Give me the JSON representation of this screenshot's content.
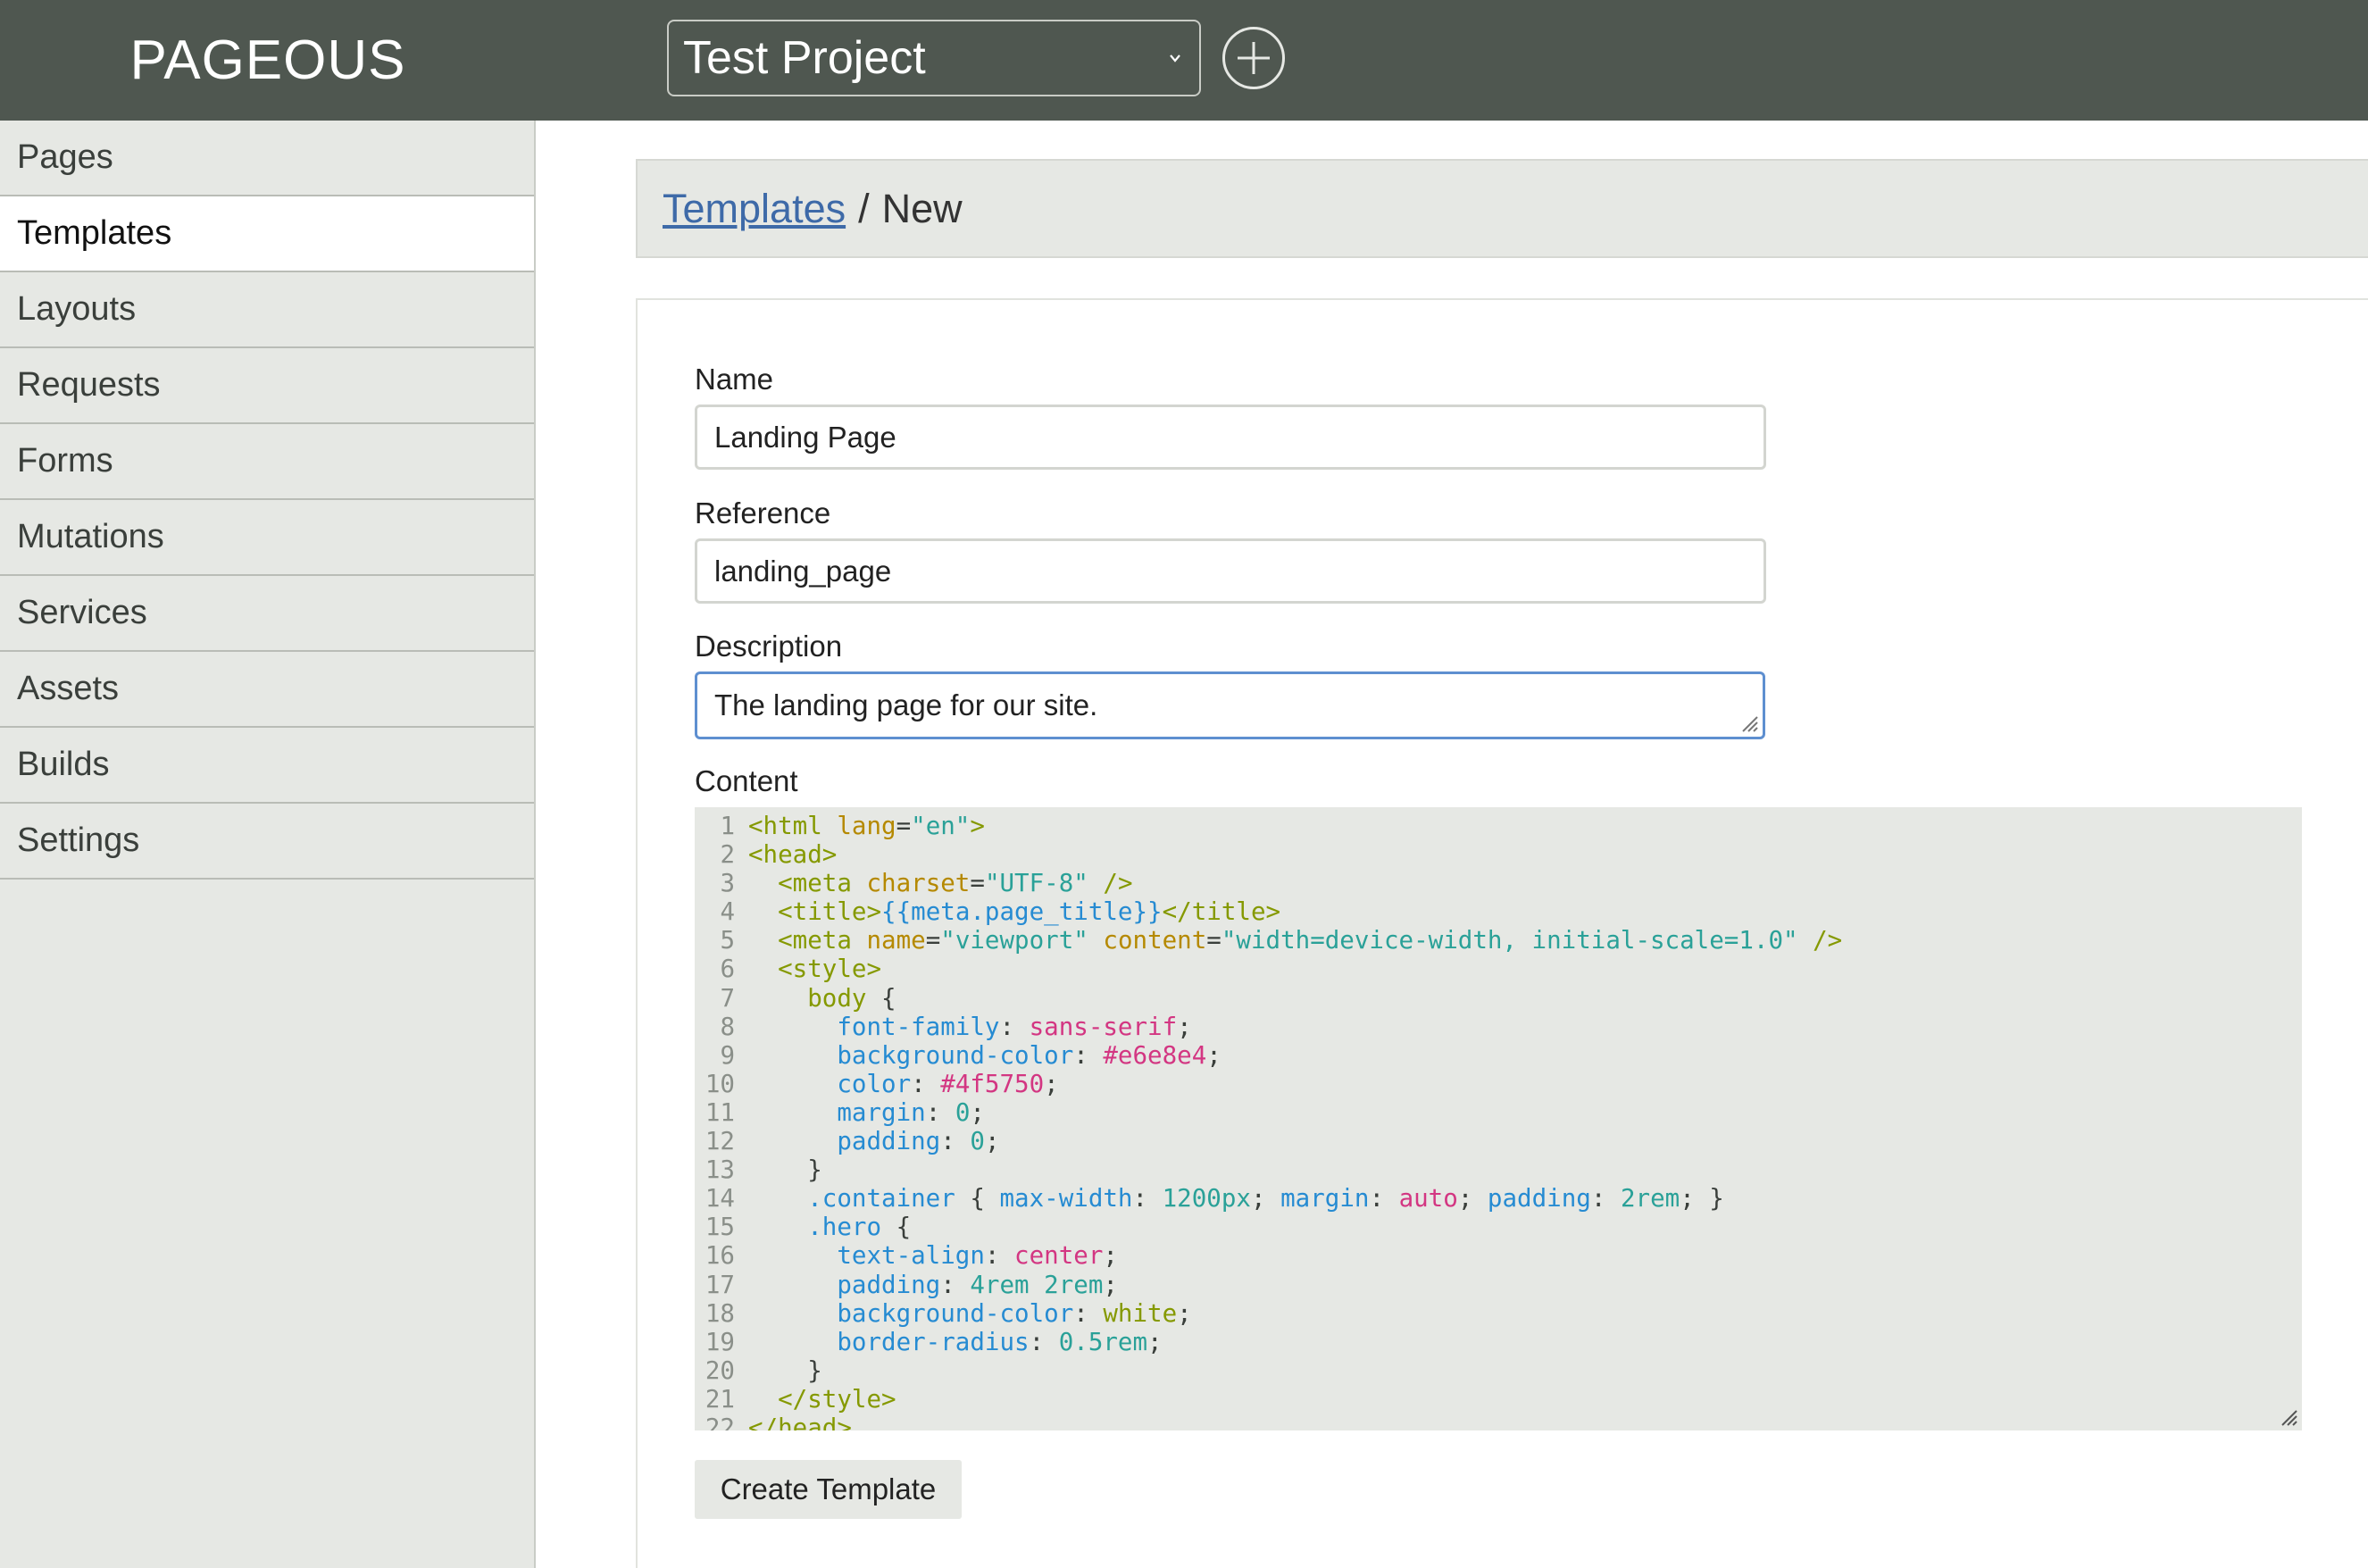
{
  "app": {
    "title": "PAGEOUS"
  },
  "project_select": {
    "value": "Test Project"
  },
  "sidebar": {
    "items": [
      {
        "label": "Pages"
      },
      {
        "label": "Templates"
      },
      {
        "label": "Layouts"
      },
      {
        "label": "Requests"
      },
      {
        "label": "Forms"
      },
      {
        "label": "Mutations"
      },
      {
        "label": "Services"
      },
      {
        "label": "Assets"
      },
      {
        "label": "Builds"
      },
      {
        "label": "Settings"
      }
    ],
    "active": "Templates"
  },
  "breadcrumb": {
    "parent": "Templates",
    "separator": "/",
    "current": "New"
  },
  "form": {
    "name_label": "Name",
    "name_value": "Landing Page",
    "reference_label": "Reference",
    "reference_value": "landing_page",
    "description_label": "Description",
    "description_value": "The landing page for our site.",
    "content_label": "Content",
    "submit_label": "Create Template"
  },
  "code_lines": [
    [
      [
        "t-tag",
        "<html "
      ],
      [
        "t-attr",
        "lang"
      ],
      [
        "",
        "="
      ],
      [
        "t-str",
        "\"en\""
      ],
      [
        "t-tag",
        ">"
      ]
    ],
    [
      [
        "t-tag",
        "<head>"
      ]
    ],
    [
      [
        "",
        "  "
      ],
      [
        "t-tag",
        "<meta "
      ],
      [
        "t-attr",
        "charset"
      ],
      [
        "",
        "="
      ],
      [
        "t-str",
        "\"UTF-8\""
      ],
      [
        "t-tag",
        " />"
      ]
    ],
    [
      [
        "",
        "  "
      ],
      [
        "t-tag",
        "<title>"
      ],
      [
        "t-var",
        "{{meta.page_title}}"
      ],
      [
        "t-tag",
        "</title>"
      ]
    ],
    [
      [
        "",
        "  "
      ],
      [
        "t-tag",
        "<meta "
      ],
      [
        "t-attr",
        "name"
      ],
      [
        "",
        "="
      ],
      [
        "t-str",
        "\"viewport\""
      ],
      [
        "t-attr",
        " content"
      ],
      [
        "",
        "="
      ],
      [
        "t-str",
        "\"width=device-width, initial-scale=1.0\""
      ],
      [
        "t-tag",
        " />"
      ]
    ],
    [
      [
        "",
        "  "
      ],
      [
        "t-tag",
        "<style>"
      ]
    ],
    [
      [
        "",
        "    "
      ],
      [
        "t-sel2",
        "body"
      ],
      [
        "",
        " {"
      ]
    ],
    [
      [
        "",
        "      "
      ],
      [
        "t-prop",
        "font-family"
      ],
      [
        "",
        ": "
      ],
      [
        "t-val",
        "sans-serif"
      ],
      [
        "",
        ";"
      ]
    ],
    [
      [
        "",
        "      "
      ],
      [
        "t-prop",
        "background-color"
      ],
      [
        "",
        ": "
      ],
      [
        "t-val",
        "#e6e8e4"
      ],
      [
        "",
        ";"
      ]
    ],
    [
      [
        "",
        "      "
      ],
      [
        "t-prop",
        "color"
      ],
      [
        "",
        ": "
      ],
      [
        "t-val",
        "#4f5750"
      ],
      [
        "",
        ";"
      ]
    ],
    [
      [
        "",
        "      "
      ],
      [
        "t-prop",
        "margin"
      ],
      [
        "",
        ": "
      ],
      [
        "t-num",
        "0"
      ],
      [
        "",
        ";"
      ]
    ],
    [
      [
        "",
        "      "
      ],
      [
        "t-prop",
        "padding"
      ],
      [
        "",
        ": "
      ],
      [
        "t-num",
        "0"
      ],
      [
        "",
        ";"
      ]
    ],
    [
      [
        "",
        "    }"
      ]
    ],
    [
      [
        "",
        "    "
      ],
      [
        "t-sel",
        ".container"
      ],
      [
        "",
        " { "
      ],
      [
        "t-prop",
        "max-width"
      ],
      [
        "",
        ": "
      ],
      [
        "t-num",
        "1200px"
      ],
      [
        "",
        "; "
      ],
      [
        "t-prop",
        "margin"
      ],
      [
        "",
        ": "
      ],
      [
        "t-val",
        "auto"
      ],
      [
        "",
        "; "
      ],
      [
        "t-prop",
        "padding"
      ],
      [
        "",
        ": "
      ],
      [
        "t-num",
        "2rem"
      ],
      [
        "",
        "; }"
      ]
    ],
    [
      [
        "",
        "    "
      ],
      [
        "t-sel",
        ".hero"
      ],
      [
        "",
        " {"
      ]
    ],
    [
      [
        "",
        "      "
      ],
      [
        "t-prop",
        "text-align"
      ],
      [
        "",
        ": "
      ],
      [
        "t-val",
        "center"
      ],
      [
        "",
        ";"
      ]
    ],
    [
      [
        "",
        "      "
      ],
      [
        "t-prop",
        "padding"
      ],
      [
        "",
        ": "
      ],
      [
        "t-num",
        "4rem 2rem"
      ],
      [
        "",
        ";"
      ]
    ],
    [
      [
        "",
        "      "
      ],
      [
        "t-prop",
        "background-color"
      ],
      [
        "",
        ": "
      ],
      [
        "t-sel2",
        "white"
      ],
      [
        "",
        ";"
      ]
    ],
    [
      [
        "",
        "      "
      ],
      [
        "t-prop",
        "border-radius"
      ],
      [
        "",
        ": "
      ],
      [
        "t-num",
        "0.5rem"
      ],
      [
        "",
        ";"
      ]
    ],
    [
      [
        "",
        "    }"
      ]
    ],
    [
      [
        "",
        "  "
      ],
      [
        "t-tag",
        "</style>"
      ]
    ],
    [
      [
        "t-tag",
        "</head>"
      ]
    ]
  ]
}
